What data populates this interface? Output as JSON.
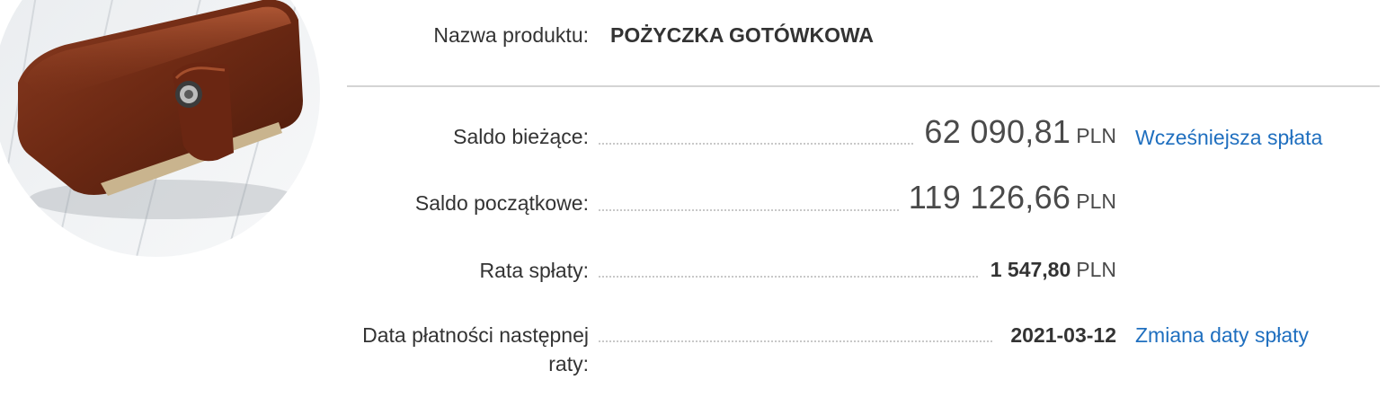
{
  "product": {
    "name_label": "Nazwa produktu:",
    "name_value": "POŻYCZKA GOTÓWKOWA"
  },
  "rows": {
    "current_balance": {
      "label": "Saldo bieżące:",
      "amount": "62 090,81",
      "currency": "PLN",
      "link": "Wcześniejsza spłata"
    },
    "initial_balance": {
      "label": "Saldo początkowe:",
      "amount": "119 126,66",
      "currency": "PLN"
    },
    "installment": {
      "label": "Rata spłaty:",
      "amount": "1 547,80",
      "currency": "PLN"
    },
    "next_payment": {
      "label": "Data płatności następnej raty:",
      "date": "2021-03-12",
      "link": "Zmiana daty spłaty"
    }
  },
  "colors": {
    "link": "#1f6fbf",
    "text": "#333333",
    "divider": "#d4d4d4"
  }
}
